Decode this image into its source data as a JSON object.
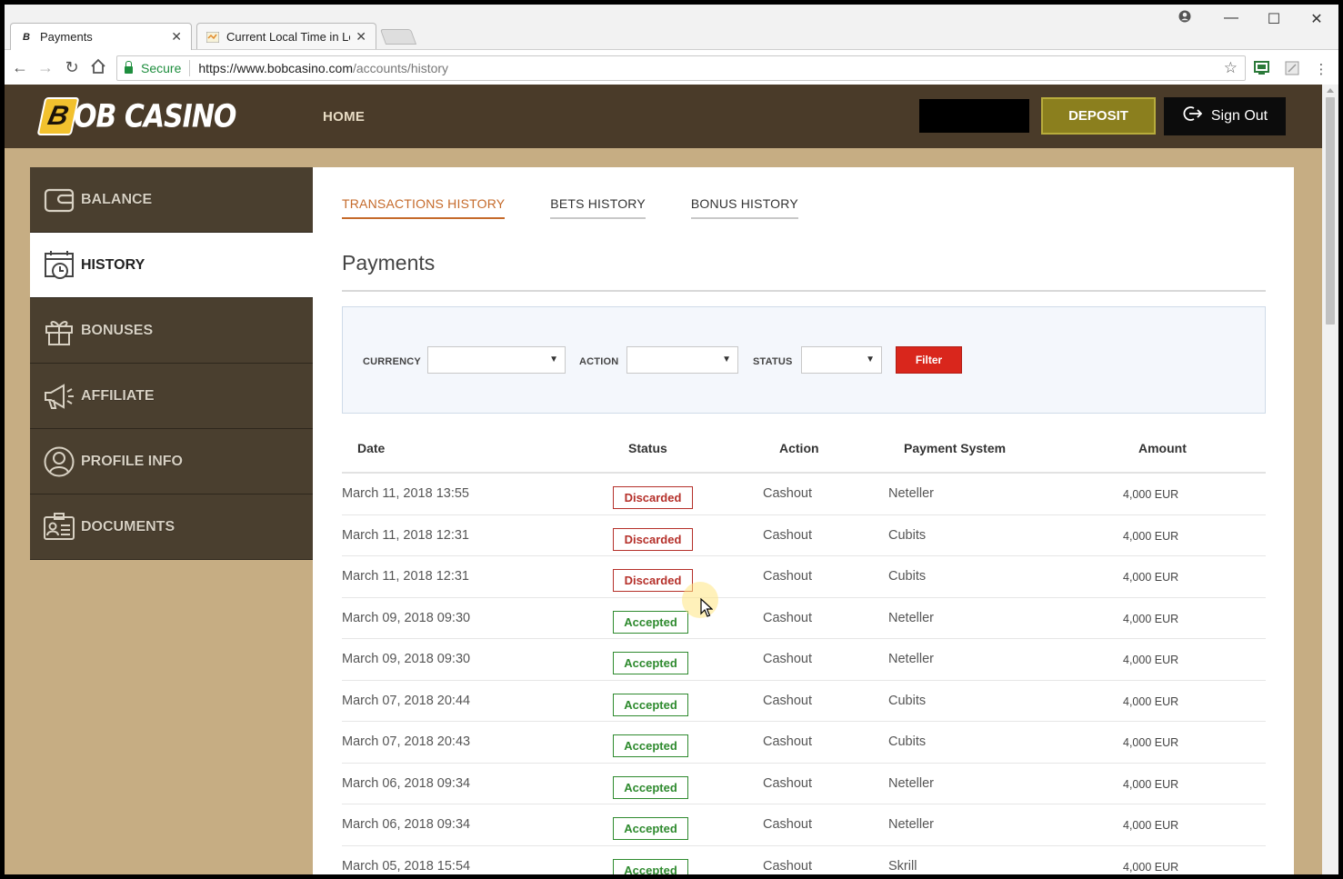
{
  "browser": {
    "tabs": [
      {
        "title": "Payments",
        "favicon": "B",
        "active": true
      },
      {
        "title": "Current Local Time in Lor",
        "favicon": "world-clock",
        "active": false
      }
    ],
    "address": {
      "secure_label": "Secure",
      "url_host": "https://www.bobcasino.com",
      "url_path": "/accounts/history"
    },
    "controls": {
      "minimize": "—",
      "maximize": "☐",
      "close": "✕"
    }
  },
  "header": {
    "logo": {
      "initial": "B",
      "text": "OB CASINO"
    },
    "nav_home": "HOME",
    "deposit_label": "DEPOSIT",
    "signout_label": "Sign Out",
    "colors": {
      "header_bg": "#4a3b29",
      "deposit_bg": "#8b7f1e",
      "page_bg": "#c6ad83"
    }
  },
  "sidebar": {
    "items": [
      {
        "label": "BALANCE",
        "icon": "wallet-icon",
        "active": false
      },
      {
        "label": "HISTORY",
        "icon": "calendar-clock-icon",
        "active": true
      },
      {
        "label": "BONUSES",
        "icon": "gift-icon",
        "active": false
      },
      {
        "label": "AFFILIATE",
        "icon": "megaphone-icon",
        "active": false
      },
      {
        "label": "PROFILE INFO",
        "icon": "user-circle-icon",
        "active": false
      },
      {
        "label": "DOCUMENTS",
        "icon": "id-card-icon",
        "active": false
      }
    ]
  },
  "main": {
    "tabs": [
      {
        "label": "TRANSACTIONS HISTORY",
        "active": true
      },
      {
        "label": "BETS HISTORY",
        "active": false
      },
      {
        "label": "BONUS HISTORY",
        "active": false
      }
    ],
    "title": "Payments",
    "filters": {
      "currency_label": "CURRENCY",
      "action_label": "ACTION",
      "status_label": "STATUS",
      "currency_value": "",
      "action_value": "",
      "status_value": "",
      "button_label": "Filter",
      "accent": "#d9261c"
    },
    "table": {
      "columns": [
        "Date",
        "Status",
        "Action",
        "Payment System",
        "Amount"
      ],
      "rows": [
        {
          "date": "March 11, 2018 13:55",
          "status": "Discarded",
          "action": "Cashout",
          "system": "Neteller",
          "amount": "4,000 EUR"
        },
        {
          "date": "March 11, 2018 12:31",
          "status": "Discarded",
          "action": "Cashout",
          "system": "Cubits",
          "amount": "4,000 EUR"
        },
        {
          "date": "March 11, 2018 12:31",
          "status": "Discarded",
          "action": "Cashout",
          "system": "Cubits",
          "amount": "4,000 EUR"
        },
        {
          "date": "March 09, 2018 09:30",
          "status": "Accepted",
          "action": "Cashout",
          "system": "Neteller",
          "amount": "4,000 EUR"
        },
        {
          "date": "March 09, 2018 09:30",
          "status": "Accepted",
          "action": "Cashout",
          "system": "Neteller",
          "amount": "4,000 EUR"
        },
        {
          "date": "March 07, 2018 20:44",
          "status": "Accepted",
          "action": "Cashout",
          "system": "Cubits",
          "amount": "4,000 EUR"
        },
        {
          "date": "March 07, 2018 20:43",
          "status": "Accepted",
          "action": "Cashout",
          "system": "Cubits",
          "amount": "4,000 EUR"
        },
        {
          "date": "March 06, 2018 09:34",
          "status": "Accepted",
          "action": "Cashout",
          "system": "Neteller",
          "amount": "4,000 EUR"
        },
        {
          "date": "March 06, 2018 09:34",
          "status": "Accepted",
          "action": "Cashout",
          "system": "Neteller",
          "amount": "4,000 EUR"
        },
        {
          "date": "March 05, 2018 15:54",
          "status": "Accepted",
          "action": "Cashout",
          "system": "Skrill",
          "amount": "4,000 EUR"
        }
      ],
      "status_colors": {
        "Discarded": "#b5302a",
        "Accepted": "#2e8a2e"
      }
    }
  }
}
